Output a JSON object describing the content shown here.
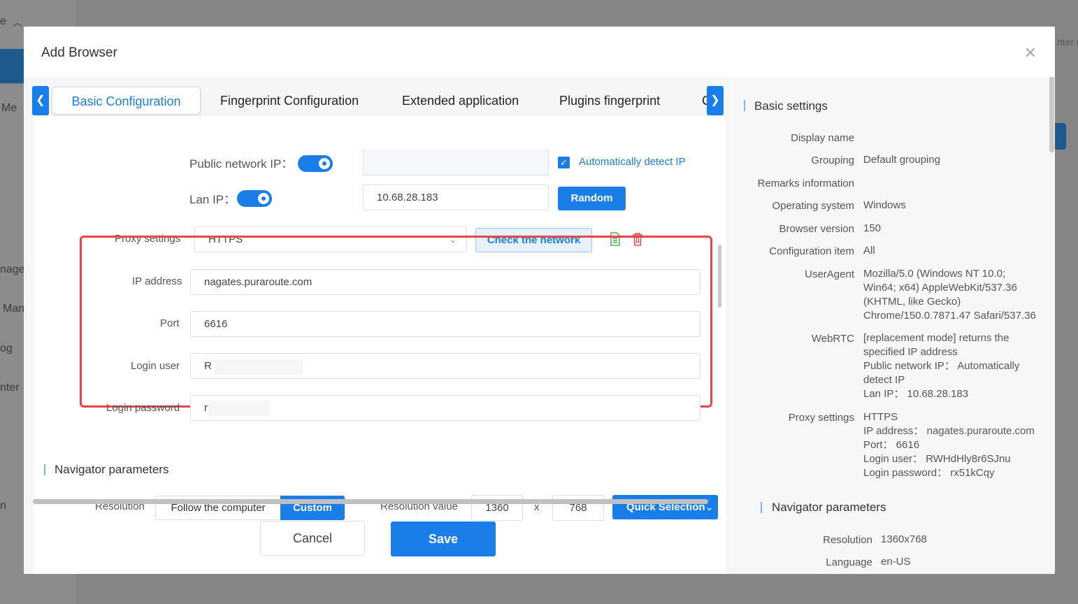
{
  "background": {
    "sidebar_fragments": [
      "e",
      "Me",
      "nage",
      "Man",
      "og",
      "nter",
      "n"
    ],
    "top_right_fragment": "nter r"
  },
  "dialog": {
    "title": "Add Browser",
    "close_icon": "close-icon"
  },
  "tabs": {
    "items": [
      "Basic Configuration",
      "Fingerprint Configuration",
      "Extended application",
      "Plugins fingerprint",
      "C"
    ],
    "active": "Basic Configuration"
  },
  "network": {
    "public_ip_label": "Public network IP：",
    "public_ip_value": "",
    "auto_detect_label": "Automatically detect IP",
    "lan_ip_label": "Lan IP：",
    "lan_ip_value": "10.68.28.183",
    "random_button": "Random"
  },
  "proxy": {
    "label": "Proxy settings",
    "type": "HTTPS",
    "check_button": "Check the network",
    "fields": {
      "ip_label": "IP address",
      "ip_value": "nagates.puraroute.com",
      "port_label": "Port",
      "port_value": "6616",
      "user_label": "Login user",
      "user_value": "R",
      "password_label": "Login password",
      "password_value": "r"
    }
  },
  "navigator": {
    "section_title": "Navigator parameters",
    "resolution_label": "Resolution",
    "follow_computer": "Follow the computer",
    "custom": "Custom",
    "resolution_value_label": "Resolution value",
    "width": "1360",
    "x_sep": "x",
    "height": "768",
    "quick_selection": "Quick Selection"
  },
  "footer": {
    "cancel": "Cancel",
    "save": "Save"
  },
  "summary": {
    "basic_title": "Basic settings",
    "rows": [
      {
        "label": "Display name",
        "value": ""
      },
      {
        "label": "Grouping",
        "value": "Default grouping"
      },
      {
        "label": "Remarks information",
        "value": ""
      },
      {
        "label": "Operating system",
        "value": "Windows"
      },
      {
        "label": "Browser version",
        "value": "150"
      },
      {
        "label": "Configuration item",
        "value": "All"
      },
      {
        "label": "UserAgent",
        "value": "Mozilla/5.0 (Windows NT 10.0; Win64; x64) AppleWebKit/537.36 (KHTML, like Gecko) Chrome/150.0.7871.47 Safari/537.36"
      },
      {
        "label": "WebRTC",
        "value": "[replacement mode] returns the specified IP address"
      },
      {
        "label": "Proxy settings",
        "value": "HTTPS"
      }
    ],
    "webrtc_extra": [
      "Public network IP：  Automatically detect IP",
      "Lan IP：  10.68.28.183"
    ],
    "proxy_extra": [
      "IP address：  nagates.puraroute.com",
      "Port：  6616",
      "Login user：  RWHdHly8r6SJnu",
      "Login password：  rx51kCqy"
    ],
    "navigator_title": "Navigator parameters",
    "nav_rows": [
      {
        "label": "Resolution",
        "value": "1360x768"
      },
      {
        "label": "Language",
        "value": "en-US"
      }
    ]
  }
}
